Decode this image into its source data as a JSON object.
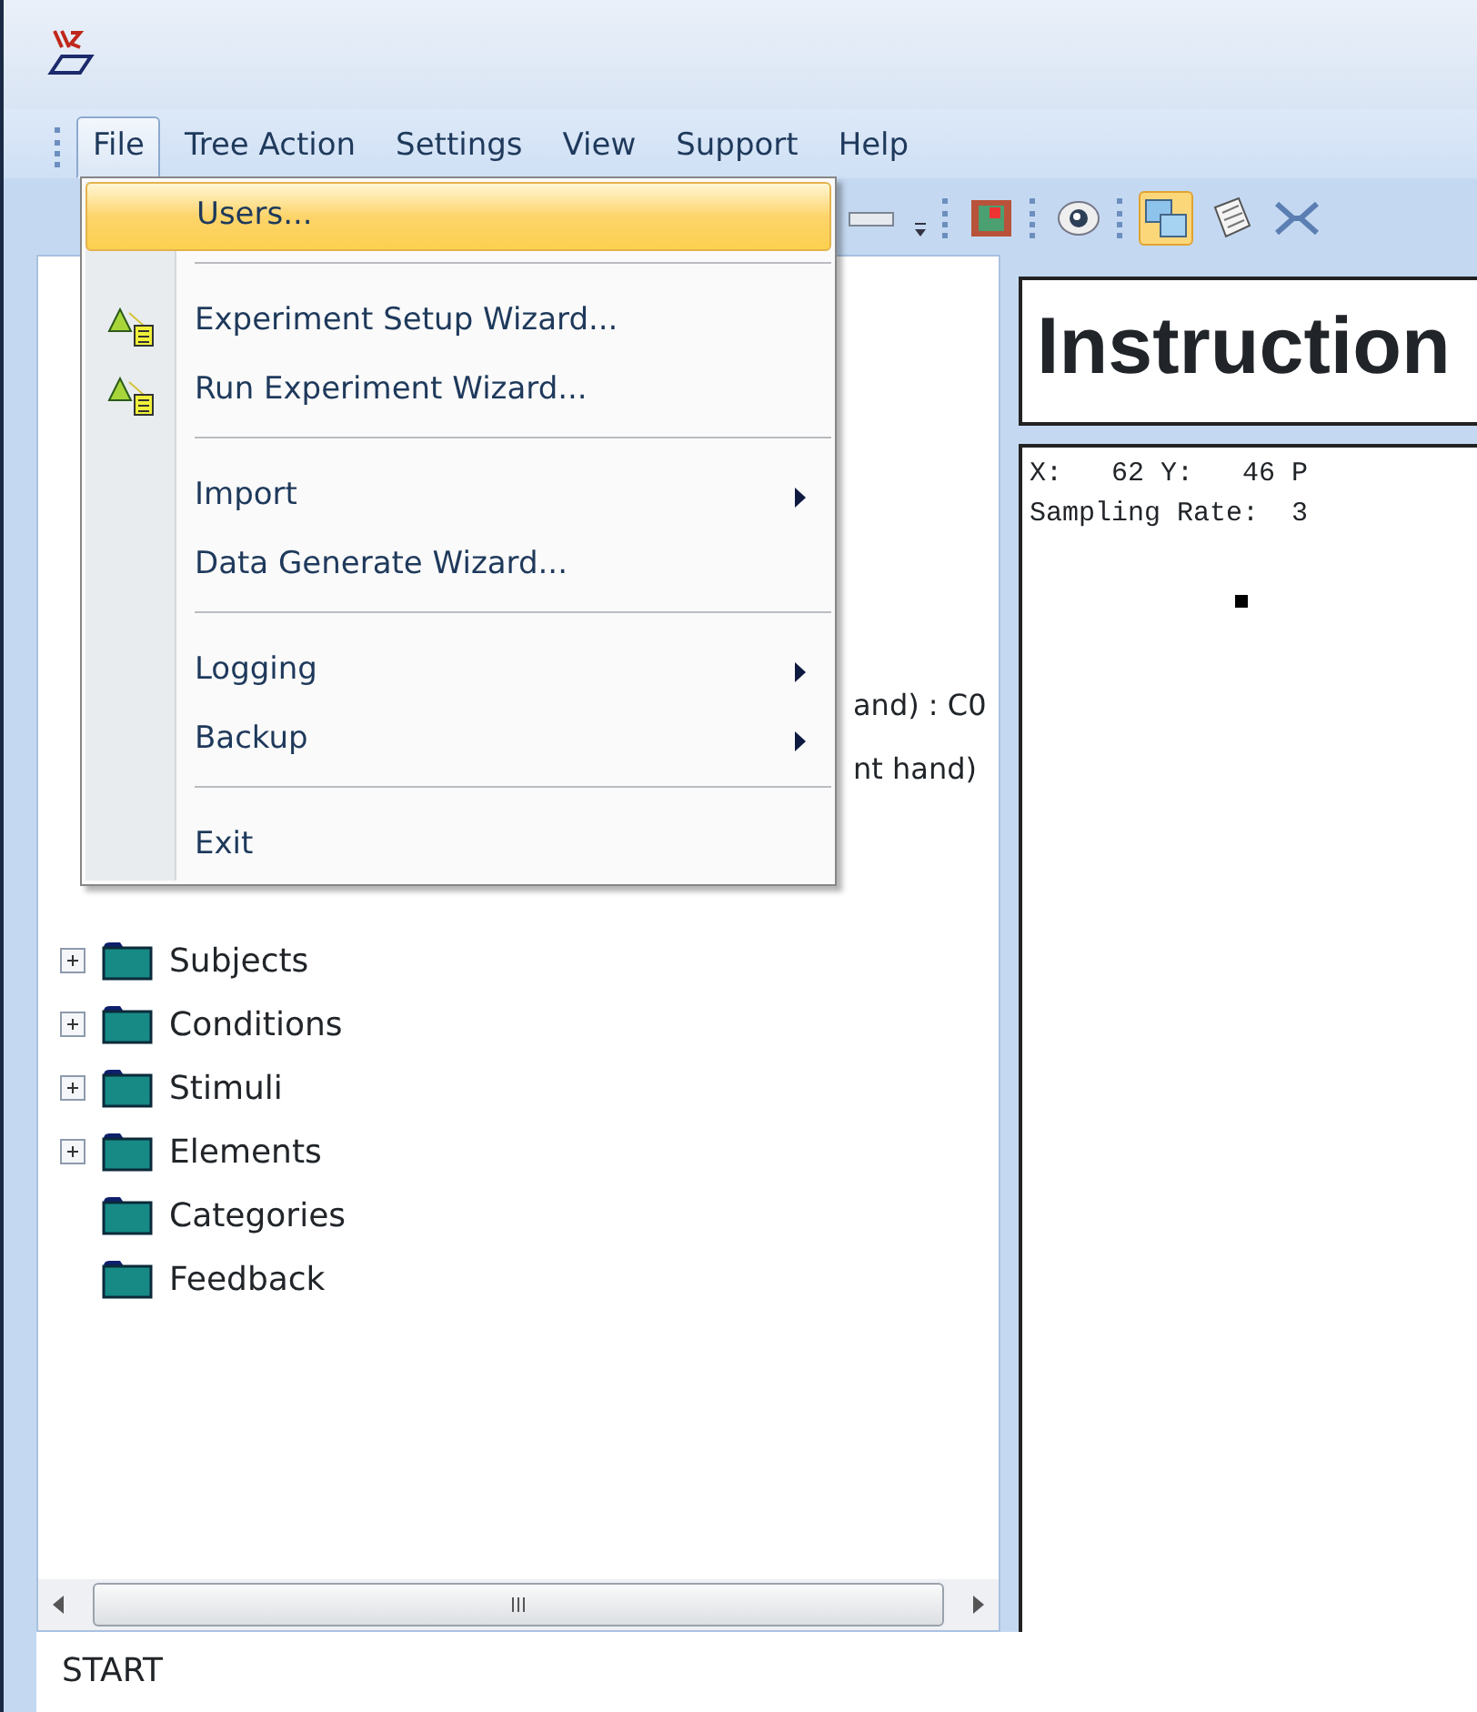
{
  "menubar": [
    {
      "label": "File",
      "selected": true
    },
    {
      "label": "Tree Action",
      "selected": false
    },
    {
      "label": "Settings",
      "selected": false
    },
    {
      "label": "View",
      "selected": false
    },
    {
      "label": "Support",
      "selected": false
    },
    {
      "label": "Help",
      "selected": false
    }
  ],
  "file_menu": [
    {
      "kind": "item",
      "label": "Users...",
      "selected": true,
      "submenu": false
    },
    {
      "kind": "separator"
    },
    {
      "kind": "icon-item",
      "label": "Experiment Setup Wizard...",
      "selected": false,
      "submenu": false
    },
    {
      "kind": "icon-item",
      "label": "Run Experiment Wizard...",
      "selected": false,
      "submenu": false
    },
    {
      "kind": "separator"
    },
    {
      "kind": "item",
      "label": "Import",
      "selected": false,
      "submenu": true
    },
    {
      "kind": "item",
      "label": "Data Generate Wizard...",
      "selected": false,
      "submenu": false
    },
    {
      "kind": "separator"
    },
    {
      "kind": "item",
      "label": "Logging",
      "selected": false,
      "submenu": true
    },
    {
      "kind": "item",
      "label": "Backup",
      "selected": false,
      "submenu": true
    },
    {
      "kind": "separator"
    },
    {
      "kind": "item",
      "label": "Exit",
      "selected": false,
      "submenu": false
    }
  ],
  "toolbar": [
    {
      "kind": "bar"
    },
    {
      "kind": "chevron"
    },
    {
      "kind": "film"
    },
    {
      "kind": "eye"
    },
    {
      "kind": "picture",
      "selected": true
    },
    {
      "kind": "notes"
    },
    {
      "kind": "shapes"
    }
  ],
  "tree": {
    "partial_rows": [
      "and) : C0",
      "nt hand)"
    ],
    "items": [
      {
        "label": "Subjects",
        "expandable": true
      },
      {
        "label": "Conditions",
        "expandable": true
      },
      {
        "label": "Stimuli",
        "expandable": true
      },
      {
        "label": "Elements",
        "expandable": true
      },
      {
        "label": "Categories",
        "expandable": false
      },
      {
        "label": "Feedback",
        "expandable": false
      }
    ]
  },
  "instruction_panel": {
    "title": "Instruction"
  },
  "display_panel": {
    "lines": [
      "X:   62 Y:   46 P",
      "Sampling Rate:  3"
    ]
  },
  "status_bar": {
    "text": "START"
  }
}
